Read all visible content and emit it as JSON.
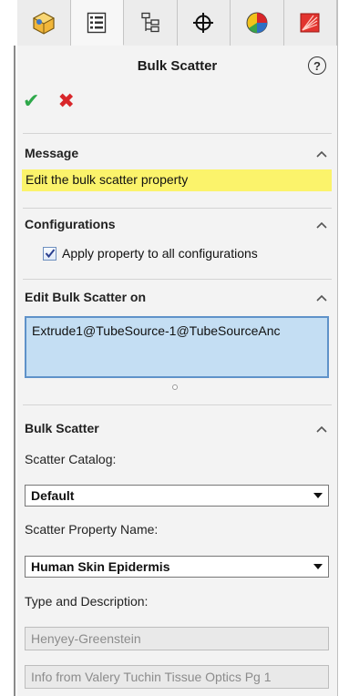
{
  "tabs": [
    {
      "id": "feature-manager",
      "icon": "feature-manager-icon"
    },
    {
      "id": "property-manager",
      "icon": "property-manager-icon"
    },
    {
      "id": "configuration-manager",
      "icon": "configuration-manager-icon"
    },
    {
      "id": "dimxpert-manager",
      "icon": "crosshair-icon"
    },
    {
      "id": "appearance-manager",
      "icon": "appearance-pie-icon"
    },
    {
      "id": "optics-manager",
      "icon": "optics-icon"
    }
  ],
  "header": {
    "title": "Bulk Scatter",
    "help_label": "?",
    "ok_label": "✔",
    "cancel_label": "✖"
  },
  "sections": {
    "message": {
      "title": "Message",
      "text": "Edit the bulk scatter property"
    },
    "configurations": {
      "title": "Configurations",
      "apply_all_label": "Apply property to all configurations",
      "apply_all_checked": true
    },
    "edit_on": {
      "title": "Edit Bulk Scatter on",
      "selection": "Extrude1@TubeSource-1@TubeSourceAnc"
    },
    "bulk_scatter": {
      "title": "Bulk Scatter",
      "catalog_label": "Scatter Catalog:",
      "catalog_value": "Default",
      "property_label": "Scatter Property Name:",
      "property_value": "Human Skin Epidermis",
      "type_label": "Type and Description:",
      "type_value": "Henyey-Greenstein",
      "description_value": "Info from Valery Tuchin Tissue Optics Pg 1"
    }
  },
  "colors": {
    "accent_ok": "#2ea84a",
    "accent_cancel": "#d8262a",
    "message_bg": "#fbf36b",
    "selection_bg": "#c4def3",
    "selection_border": "#5f92c9"
  }
}
